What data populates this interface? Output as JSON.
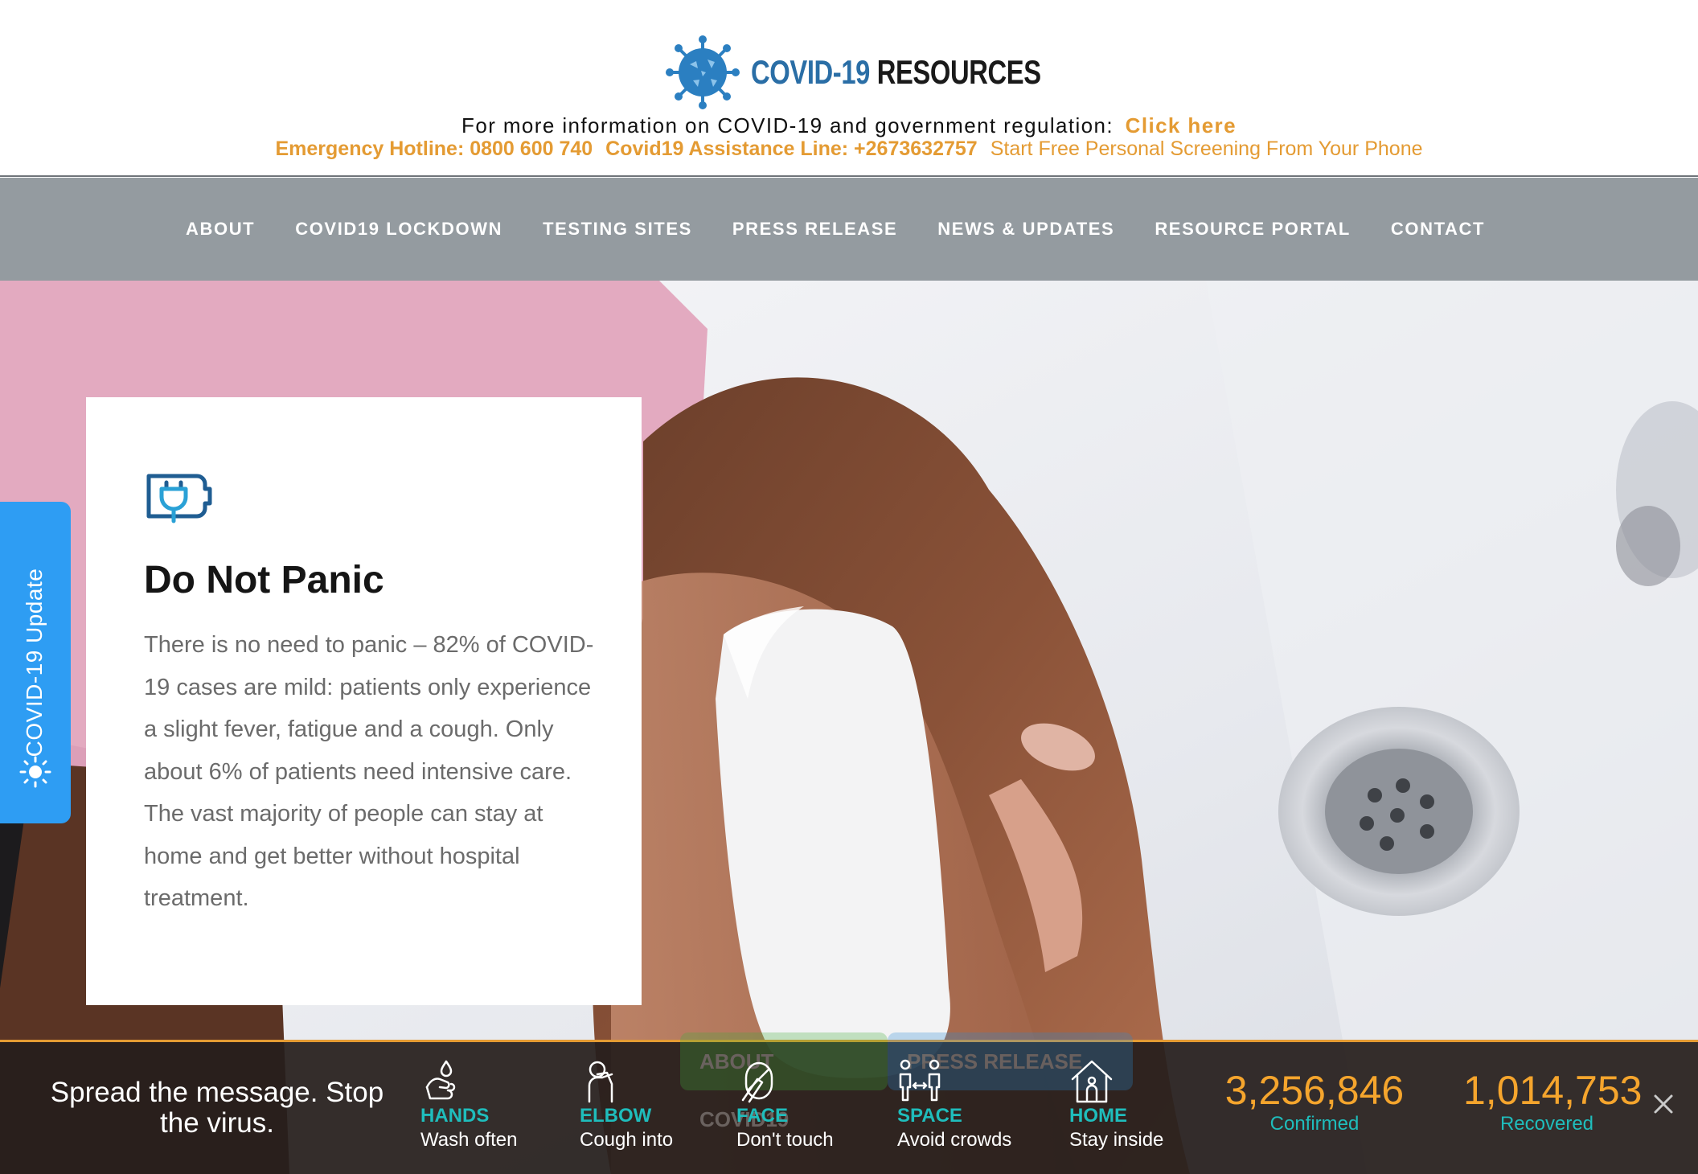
{
  "header": {
    "logo_part1": "COVID-19",
    "logo_part2": "RESOURCES",
    "info_text": "For more information on COVID-19 and government regulation:",
    "info_link": "Click here",
    "emergency": "Emergency Hotline: 0800 600 740",
    "assistance": "Covid19 Assistance Line: +2673632757",
    "screening": "Start Free Personal Screening From Your Phone"
  },
  "nav": {
    "items": [
      "ABOUT",
      "COVID19 LOCKDOWN",
      "TESTING SITES",
      "PRESS RELEASE",
      "NEWS & UPDATES",
      "RESOURCE PORTAL",
      "CONTACT"
    ]
  },
  "side_tab": {
    "label": "COVID-19 Update"
  },
  "card": {
    "title": "Do Not Panic",
    "body": "There is no need to panic – 82% of COVID-19 cases are mild: patients only experience a slight fever, fatigue and a cough. Only about 6% of patients need intensive care. The vast majority of people can stay at home and get better without hospital treatment."
  },
  "ribbon": {
    "buttons": [
      "ABOUT COVID19",
      "PRESS RELEASE"
    ],
    "slogan": "Spread the message. Stop the virus.",
    "tips": [
      {
        "title": "HANDS",
        "sub": "Wash often",
        "icon": "hand-wash-icon"
      },
      {
        "title": "ELBOW",
        "sub": "Cough into",
        "icon": "elbow-cough-icon"
      },
      {
        "title": "FACE",
        "sub": "Don't touch",
        "icon": "face-icon"
      },
      {
        "title": "SPACE",
        "sub": "Avoid crowds",
        "icon": "distance-icon"
      },
      {
        "title": "HOME",
        "sub": "Stay inside",
        "icon": "home-icon"
      }
    ],
    "confirmed_value": "3,256,846",
    "confirmed_label": "Confirmed",
    "recovered_value": "1,014,753",
    "recovered_label": "Recovered"
  },
  "colors": {
    "accent_orange": "#e49b33",
    "nav_gray": "#949ba0",
    "tab_blue": "#2e9df3",
    "teal": "#1fbdbc",
    "stat_orange": "#f5a52d"
  }
}
